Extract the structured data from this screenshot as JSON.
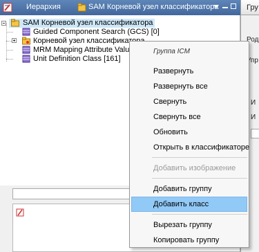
{
  "titlebar": {
    "title": "Иерархия",
    "node_label": "SAM Корневой узел классификатора"
  },
  "tree": {
    "root": "SAM Корневой узел классификатора",
    "children": [
      "Guided Component Search (GCS)  [0]",
      "Корневой узел классификатора",
      "MRM Mapping Attribute Value",
      "Unit Definition Class  [161]"
    ]
  },
  "right_pane": {
    "tab": "Гру",
    "labels": [
      "Роди",
      "Упр",
      "И",
      "И"
    ]
  },
  "context_menu": {
    "header": "Группа  ICM",
    "items": [
      {
        "label": "Развернуть",
        "enabled": true
      },
      {
        "label": "Развернуть все",
        "enabled": true
      },
      {
        "label": "Свернуть",
        "enabled": true
      },
      {
        "label": "Свернуть все",
        "enabled": true
      },
      {
        "label": "Обновить",
        "enabled": true
      },
      {
        "label": "Открыть в классификаторе",
        "enabled": true
      },
      {
        "label": "Добавить изображение",
        "enabled": false
      },
      {
        "label": "Добавить группу",
        "enabled": true
      },
      {
        "label": "Добавить класс",
        "enabled": true,
        "highlighted": true
      },
      {
        "label": "Вырезать группу",
        "enabled": true
      },
      {
        "label": "Копировать группу",
        "enabled": true
      }
    ]
  },
  "colors": {
    "titlebar": "#4f76ab",
    "selection": "#cde7f8",
    "menu_highlight": "#91c9f7",
    "disabled_text": "#9a9a9a"
  }
}
